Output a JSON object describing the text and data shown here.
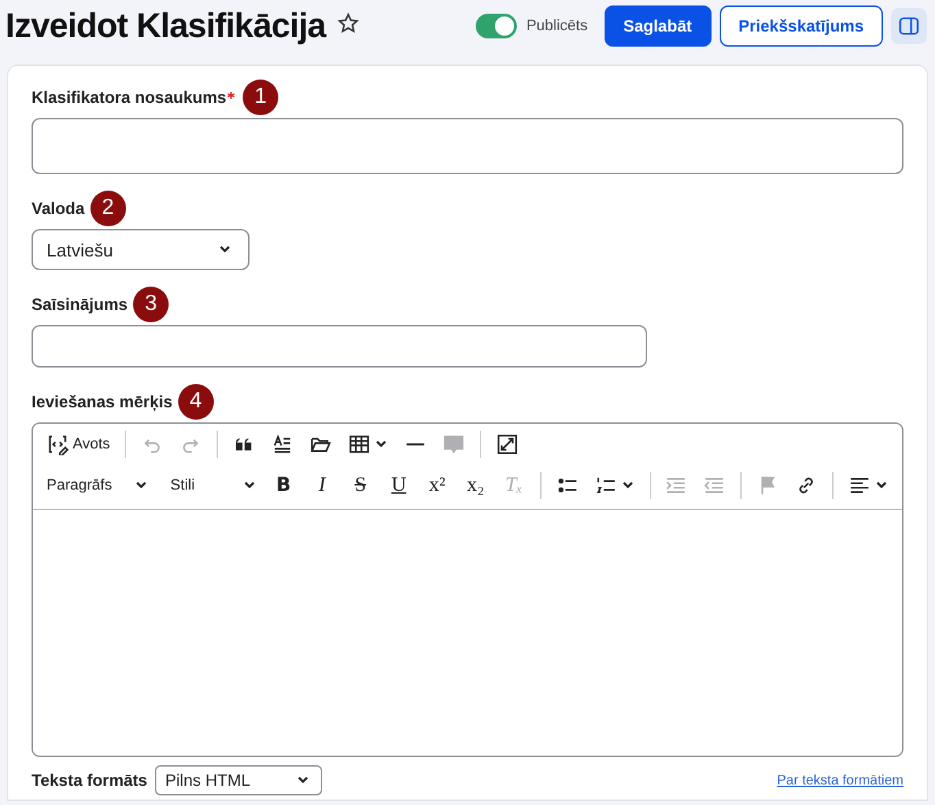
{
  "page": {
    "title": "Izveidot Klasifikācija",
    "favorite": false
  },
  "actions": {
    "published": {
      "label": "Publicēts",
      "on": true
    },
    "save": "Saglabāt",
    "preview": "Priekšskatījums"
  },
  "fields": [
    {
      "kind": "text",
      "label": "Klasifikatora nosaukums",
      "required": true,
      "badge": "1"
    },
    {
      "kind": "select",
      "label": "Valoda",
      "required": false,
      "badge": "2",
      "value": "Latviešu"
    },
    {
      "kind": "short",
      "label": "Saīsinājums",
      "required": false,
      "badge": "3"
    },
    {
      "kind": "editor",
      "label": "Ieviešanas mērķis",
      "required": false,
      "badge": "4"
    }
  ],
  "toolbar_rows": [
    [
      {
        "kind": "button",
        "label": "Avots",
        "disabled": false
      },
      {
        "kind": "sep"
      },
      {
        "kind": "button",
        "disabled": true
      },
      {
        "kind": "button",
        "disabled": true
      },
      {
        "kind": "sep"
      },
      {
        "kind": "button",
        "disabled": false
      },
      {
        "kind": "button",
        "disabled": false
      },
      {
        "kind": "button",
        "disabled": false
      },
      {
        "kind": "split",
        "disabled": false
      },
      {
        "kind": "button",
        "disabled": false
      },
      {
        "kind": "button",
        "disabled": true
      },
      {
        "kind": "sep"
      },
      {
        "kind": "button",
        "disabled": false
      }
    ],
    [
      {
        "kind": "select",
        "label": "Paragrāfs"
      },
      {
        "kind": "select",
        "label": "Stili"
      },
      {
        "kind": "glyph",
        "glyph": "B",
        "disabled": false
      },
      {
        "kind": "glyph",
        "glyph": "I",
        "disabled": false
      },
      {
        "kind": "glyph",
        "glyph": "S",
        "disabled": false
      },
      {
        "kind": "glyph",
        "glyph": "U",
        "disabled": false
      },
      {
        "kind": "glyph",
        "glyph": "x²",
        "disabled": false
      },
      {
        "kind": "glyph",
        "glyph": "x₂",
        "disabled": false
      },
      {
        "kind": "glyph",
        "glyph": "Tₓ",
        "disabled": true
      },
      {
        "kind": "sep"
      },
      {
        "kind": "button",
        "disabled": false
      },
      {
        "kind": "split",
        "disabled": false
      },
      {
        "kind": "sep"
      },
      {
        "kind": "button",
        "disabled": true
      },
      {
        "kind": "button",
        "disabled": true
      },
      {
        "kind": "sep"
      },
      {
        "kind": "button",
        "disabled": true
      },
      {
        "kind": "button",
        "disabled": false
      },
      {
        "kind": "sep"
      },
      {
        "kind": "split",
        "disabled": false
      }
    ]
  ],
  "footer": {
    "label": "Teksta formāts",
    "format": "Pilns HTML",
    "link": "Par teksta formātiem"
  }
}
